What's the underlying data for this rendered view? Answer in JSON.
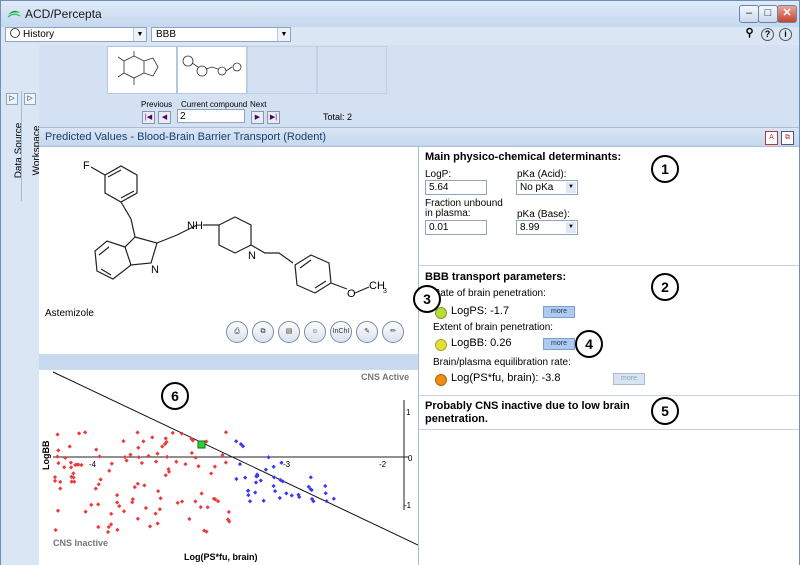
{
  "window": {
    "title": "ACD/Percepta",
    "min": "–",
    "max": "□",
    "close": "✕"
  },
  "toolbar": {
    "history": "History",
    "model": "BBB"
  },
  "sidebar": {
    "data_source": "Data Source",
    "workspace": "Workspace"
  },
  "navigator": {
    "previous": "Previous",
    "current": "Current compound",
    "next": "Next",
    "current_value": "2",
    "total": "Total: 2"
  },
  "header": {
    "title": "Predicted Values - Blood-Brain Barrier Transport (Rodent)"
  },
  "molecule": {
    "name": "Astemizole",
    "atom_F": "F",
    "atom_N": "N",
    "atom_NH": "NH",
    "atom_O": "O",
    "atom_CH3": "CH",
    "atom_3": "3"
  },
  "actions": [
    "⎙",
    "⧉",
    "▤",
    "☺",
    "InChI",
    "✎",
    "✏"
  ],
  "physchem": {
    "title": "Main physico-chemical determinants:",
    "logp_label": "LogP:",
    "logp_value": "5.64",
    "pka_acid_label": "pKa (Acid):",
    "pka_acid_value": "No pKa",
    "fu_label_1": "Fraction unbound",
    "fu_label_2": "in plasma:",
    "fu_value": "0.01",
    "pka_base_label": "pKa (Base):",
    "pka_base_value": "8.99"
  },
  "bbb": {
    "title": "BBB transport parameters:",
    "rate_label": "Rate of brain penetration:",
    "logps": "LogPS:  -1.7",
    "extent_label": "Extent of brain penetration:",
    "logbb": "LogBB:  0.26",
    "equil_label": "Brain/plasma equilibration rate:",
    "logpsfu": "Log(PS*fu, brain):  -3.8",
    "more": "more",
    "colors": {
      "green": "#b8dc3a",
      "yellow": "#dfe23a",
      "orange": "#f08c14"
    }
  },
  "conclusion": "Probably CNS inactive due to low brain penetration.",
  "callouts": [
    "1",
    "2",
    "3",
    "4",
    "5",
    "6"
  ],
  "plot": {
    "label_active": "CNS Active",
    "label_inactive": "CNS Inactive",
    "xlabel": "Log(PS*fu, brain)",
    "ylabel": "LogBB",
    "xticks": [
      "-4",
      "-3",
      "-2"
    ],
    "yticks": [
      "1",
      "0",
      "-1"
    ]
  }
}
